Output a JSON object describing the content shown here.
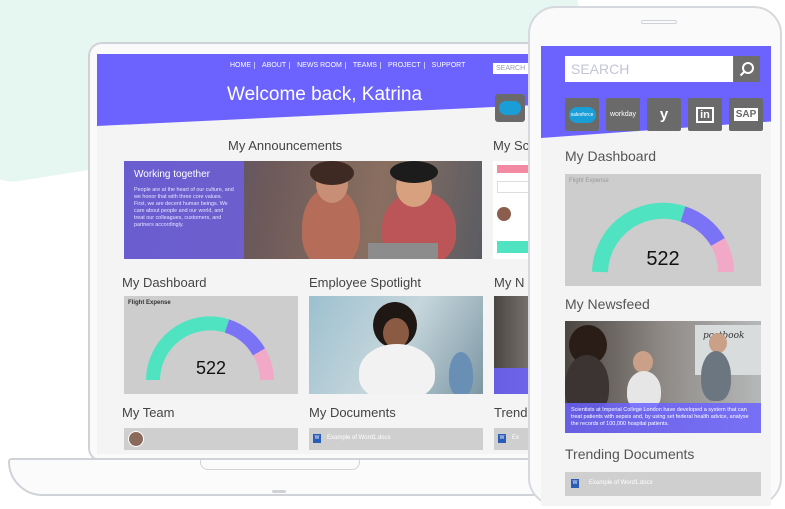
{
  "colors": {
    "brand": "#6c63ff",
    "gauge_teal": "#4fe3c1",
    "gauge_purple": "#7b73f5",
    "gauge_pink": "#f2a9c8",
    "mint_bg": "#e6f6f1"
  },
  "laptop": {
    "nav": [
      "HOME",
      "ABOUT",
      "NEWS ROOM",
      "TEAMS",
      "PROJECT",
      "SUPPORT"
    ],
    "search_placeholder": "SEARCH",
    "welcome": "Welcome back, Katrina",
    "sections": {
      "announcements": "My Announcements",
      "social": "My Sc",
      "dashboard": "My Dashboard",
      "spotlight": "Employee Spotlight",
      "newsfeed": "My N",
      "team": "My Team",
      "documents": "My Documents",
      "trending": "Trend"
    },
    "announcement": {
      "heading": "Working together",
      "body": "People are at the heart of our culture, and we honor that with three core values. First, we are decent human beings. We care about people and our world, and treat our colleagues, customers, and partners accordingly."
    },
    "gauge": {
      "label": "Flight Expense",
      "value": "522"
    },
    "document_item": "Example of Word1.docx",
    "trending_item": "Ex"
  },
  "phone": {
    "search_placeholder": "SEARCH",
    "apps": [
      "salesforce",
      "workday",
      "yammer",
      "linkedin",
      "sap"
    ],
    "app_labels": {
      "salesforce": "salesforce",
      "workday": "workday",
      "yammer": "y",
      "linkedin": "in",
      "sap": "SAP"
    },
    "dashboard_title": "My Dashboard",
    "gauge": {
      "label": "Flight Expense",
      "value": "522"
    },
    "newsfeed_title": "My Newsfeed",
    "news_caption": "Scientists at Imperial College London have developed a system that can treat patients with sepsis and, by using set federal health advice, analyse the records of 100,000 hospital patients.",
    "whiteboard_text": "postbook",
    "trending_title": "Trending Documents",
    "trending_item": "Example of Word1.docx"
  }
}
